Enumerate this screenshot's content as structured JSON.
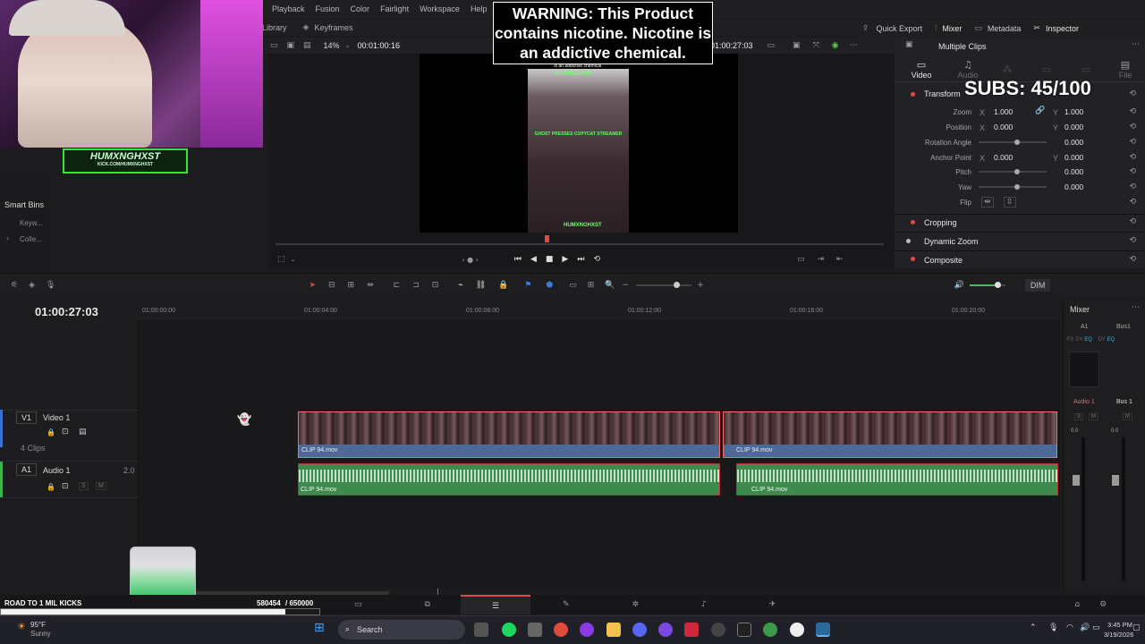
{
  "menu": [
    "Playback",
    "Fusion",
    "Color",
    "Fairlight",
    "Workspace",
    "Help"
  ],
  "top_left_tabs": {
    "library": "Library",
    "keyframes": "Keyframes"
  },
  "top_right": {
    "quick_export": "Quick Export",
    "mixer": "Mixer",
    "metadata": "Metadata",
    "inspector": "Inspector"
  },
  "warning": "WARNING: This Product contains nicotine. Nicotine is an addictive chemical.",
  "overlay": {
    "channel": "HUMXNGHXST",
    "channel_sub": "KICK.COM/HUMXNGHXST",
    "subs": "SUBS: 45/100",
    "goal_label": "ROAD TO 1 MIL KICKS",
    "goal_value": "580454",
    "goal_target": "/ 650000",
    "goal_progress_fraction": 0.893
  },
  "viewer": {
    "zoom": "14%",
    "timecode_left": "00:01:00:16",
    "timecode_right": "01:00:27:03",
    "video_caption": "is an addictive chemical.",
    "video_title": "GHOST PRESSES COPYCAT STREAMER",
    "video_tag": "HUMXNGHXST"
  },
  "left_panel": {
    "smart_bins": "Smart Bins",
    "keywords": "Keyw...",
    "collections": "Colle..."
  },
  "inspector": {
    "title": "Multiple Clips",
    "tabs": [
      "Video",
      "Audio",
      "Effects",
      "Transition",
      "Image",
      "File"
    ],
    "transform": "Transform",
    "zoom": {
      "label": "Zoom",
      "x": "1.000",
      "y": "1.000"
    },
    "position": {
      "label": "Position",
      "x": "0.000",
      "y": "0.000"
    },
    "rotation": {
      "label": "Rotation Angle",
      "value": "0.000"
    },
    "anchor": {
      "label": "Anchor Point",
      "x": "0.000",
      "y": "0.000"
    },
    "pitch": {
      "label": "Pitch",
      "value": "0.000"
    },
    "yaw": {
      "label": "Yaw",
      "value": "0.000"
    },
    "flip": {
      "label": "Flip"
    },
    "sections": [
      "Cropping",
      "Dynamic Zoom",
      "Composite"
    ]
  },
  "timeline": {
    "timecode": "01:00:27:03",
    "ruler": [
      "01:00:00:00",
      "01:00:04:00",
      "01:00:08:00",
      "01:00:12:00",
      "01:00:16:00",
      "01:00:20:00"
    ],
    "v1": {
      "id": "V1",
      "name": "Video 1",
      "clips": "4 Clips"
    },
    "a1": {
      "id": "A1",
      "name": "Audio 1",
      "channels": "2.0"
    },
    "clip_name": "CLIP 94.mov",
    "dim": "DIM"
  },
  "mixer": {
    "title": "Mixer",
    "a1": "A1",
    "bus1": "Bus1",
    "audio1": "Audio 1",
    "bus1b": "Bus 1",
    "db": "0.0"
  },
  "taskbar": {
    "weather_temp": "95°F",
    "weather_cond": "Sunny",
    "search": "Search",
    "time": "3:45 PM",
    "date": "3/19/2026"
  }
}
